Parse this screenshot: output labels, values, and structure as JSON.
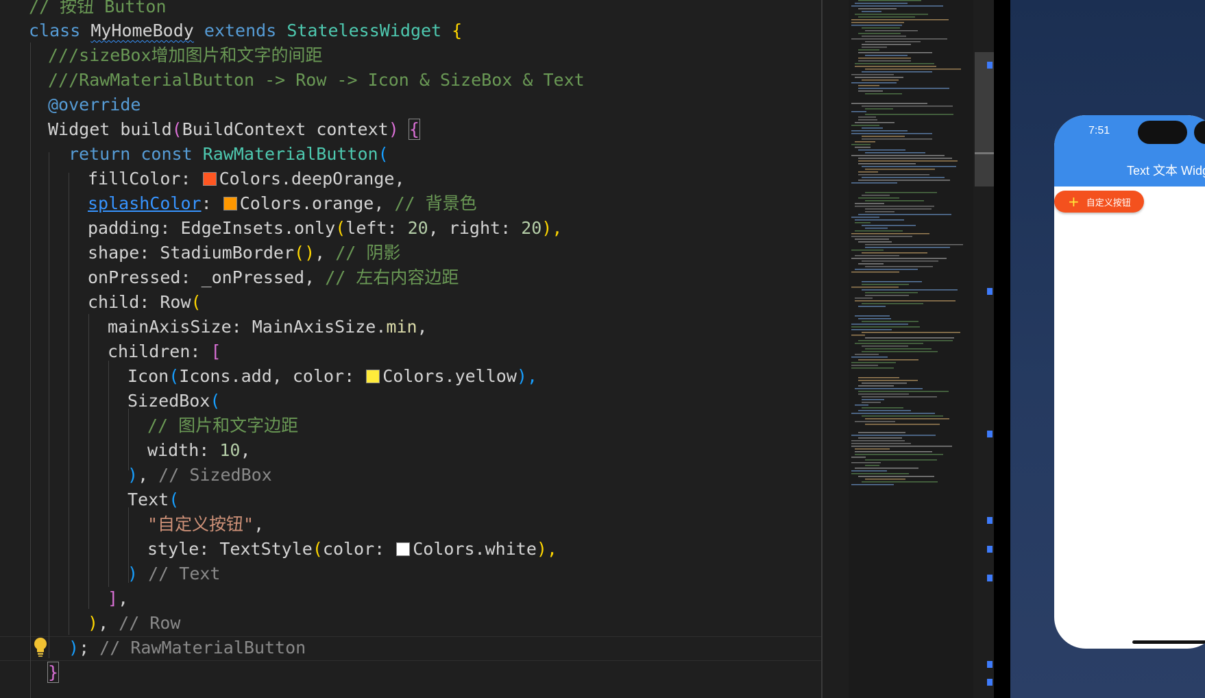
{
  "editor": {
    "lines": [
      [
        "// 按钮 Button"
      ],
      [
        "class",
        " ",
        "MyHomeBody",
        " ",
        "extends",
        " ",
        "StatelessWidget",
        " ",
        "{"
      ],
      [
        "///sizeBox增加图片和文字的间距"
      ],
      [
        "///RawMaterialButton -> Row -> Icon & SizeBox & Text"
      ],
      [
        "@override"
      ],
      [
        "Widget build",
        "(",
        "BuildContext context",
        ")",
        " ",
        "{"
      ],
      [
        "return",
        " ",
        "const",
        " ",
        "RawMaterialButton",
        "("
      ],
      [
        "fillColor: ",
        "Colors.deepOrange,"
      ],
      [
        "splashColor",
        ": ",
        "Colors.orange, ",
        "// 背景色"
      ],
      [
        "padding: EdgeInsets.only",
        "(",
        "left: ",
        "20",
        ", right: ",
        "20",
        "),"
      ],
      [
        "shape: StadiumBorder",
        "()",
        ", ",
        "// 阴影"
      ],
      [
        "onPressed: _onPressed, ",
        "// 左右内容边距"
      ],
      [
        "child: Row",
        "("
      ],
      [
        "mainAxisSize: MainAxisSize.",
        "min",
        ","
      ],
      [
        "children: ",
        "["
      ],
      [
        "Icon",
        "(",
        "Icons.add, color: ",
        "Colors.yellow",
        "),"
      ],
      [
        "SizedBox",
        "("
      ],
      [
        "// 图片和文字边距"
      ],
      [
        "width: ",
        "10",
        ","
      ],
      [
        ")",
        ", ",
        "// SizedBox"
      ],
      [
        "Text",
        "("
      ],
      [
        "\"自定义按钮\"",
        ","
      ],
      [
        "style: TextStyle",
        "(",
        "color: ",
        "Colors.white",
        "),"
      ],
      [
        ")",
        " ",
        "// Text"
      ],
      [
        "]",
        ","
      ],
      [
        ")",
        ", ",
        "// Row"
      ],
      [
        ")",
        "; ",
        "// RawMaterialButton"
      ],
      [
        "}"
      ]
    ],
    "swatches": {
      "deep_orange": "#ff5722",
      "orange": "#ff9800",
      "yellow": "#ffeb3b",
      "white": "#ffffff"
    }
  },
  "simulator": {
    "time": "7:51",
    "appbar_title": "Text 文本 Widget",
    "button_icon": "+",
    "button_label": "自定义按钮",
    "colors": {
      "appbar": "#3b8bea",
      "button": "#f4511e",
      "icon": "#ffeb3b"
    }
  },
  "icons": [
    "lightbulb-icon",
    "add-icon"
  ]
}
